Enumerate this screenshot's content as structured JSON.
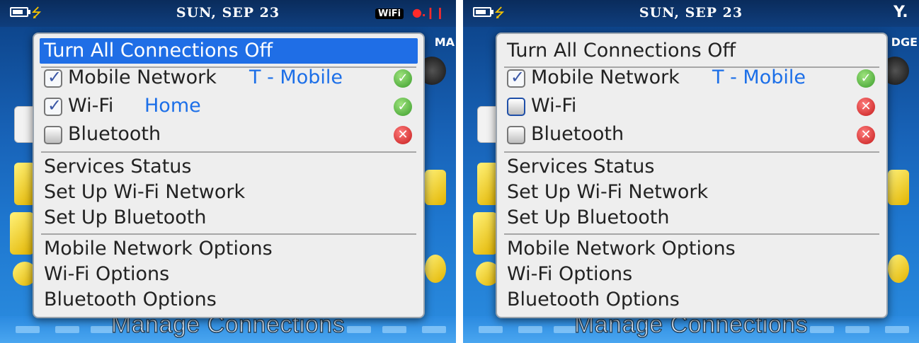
{
  "screens": {
    "left": {
      "status": {
        "date": "SUN, SEP 23",
        "wifi_badge": "WiFi",
        "signal_text": "●․ ",
        "edge": "MA"
      },
      "menu": {
        "turn_off": "Turn All Connections Off",
        "connections": [
          {
            "label": "Mobile Network",
            "value": "T - Mobile",
            "checked": true,
            "status": "on"
          },
          {
            "label": "Wi-Fi",
            "value": "Home",
            "checked": true,
            "status": "on"
          },
          {
            "label": "Bluetooth",
            "value": "",
            "checked": false,
            "status": "off"
          }
        ],
        "services": [
          "Services Status",
          "Set Up Wi-Fi Network",
          "Set Up Bluetooth"
        ],
        "options": [
          "Mobile Network Options",
          "Wi-Fi Options",
          "Bluetooth Options"
        ]
      },
      "app_title": "Manage Connections"
    },
    "right": {
      "status": {
        "date": "SUN, SEP 23",
        "signal_icon": "Y.",
        "edge": "DGE"
      },
      "menu": {
        "turn_off": "Turn All Connections Off",
        "connections": [
          {
            "label": "Mobile Network",
            "value": "T - Mobile",
            "checked": true,
            "status": "on"
          },
          {
            "label": "Wi-Fi",
            "value": "",
            "checked": false,
            "status": "off"
          },
          {
            "label": "Bluetooth",
            "value": "",
            "checked": false,
            "status": "off"
          }
        ],
        "services": [
          "Services Status",
          "Set Up Wi-Fi Network",
          "Set Up Bluetooth"
        ],
        "options": [
          "Mobile Network Options",
          "Wi-Fi Options",
          "Bluetooth Options"
        ]
      },
      "app_title": "Manage Connections"
    }
  },
  "icons": {
    "battery": "battery-icon",
    "charging": "charging-icon",
    "checkbox_checked": "checkmark-icon",
    "status_on": "green-check-icon",
    "status_off": "red-x-icon"
  },
  "colors": {
    "highlight": "#1f6ee6",
    "value_text": "#1c6fe8",
    "status_on": "#3a9c2b",
    "status_off": "#c41919",
    "status_bar": "#0a2c5c"
  }
}
